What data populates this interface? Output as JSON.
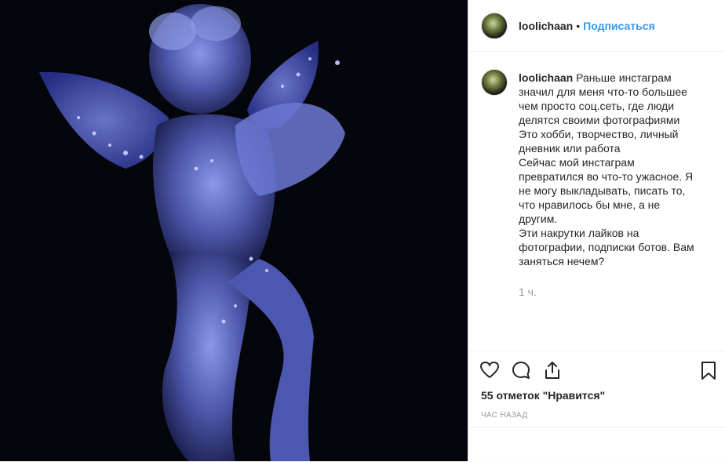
{
  "header": {
    "username": "loolichaan",
    "separator": "•",
    "follow_label": "Подписаться"
  },
  "caption": {
    "username": "loolichaan",
    "text": "Раньше инстаграм значил для меня что-то большее чем просто соц.сеть, где люди делятся своими фотографиями\nЭто хобби, творчество, личный дневник или работа\nСейчас мой инстаграм превратился во что-то ужасное. Я не могу выкладывать, писать то, что нравилось бы мне, а не другим.\nЭти накрутки лайков на фотографии, подписки ботов. Вам заняться нечем?",
    "time": "1 ч."
  },
  "actions": {
    "like_icon": "heart-icon",
    "comment_icon": "comment-icon",
    "share_icon": "share-icon",
    "save_icon": "bookmark-icon"
  },
  "likes_text": "55 отметок \"Нравится\"",
  "posted_time": "час назад",
  "colors": {
    "accent": "#3897f0",
    "photo_bg": "#05060c",
    "angel_blue": "#5a68c8"
  }
}
